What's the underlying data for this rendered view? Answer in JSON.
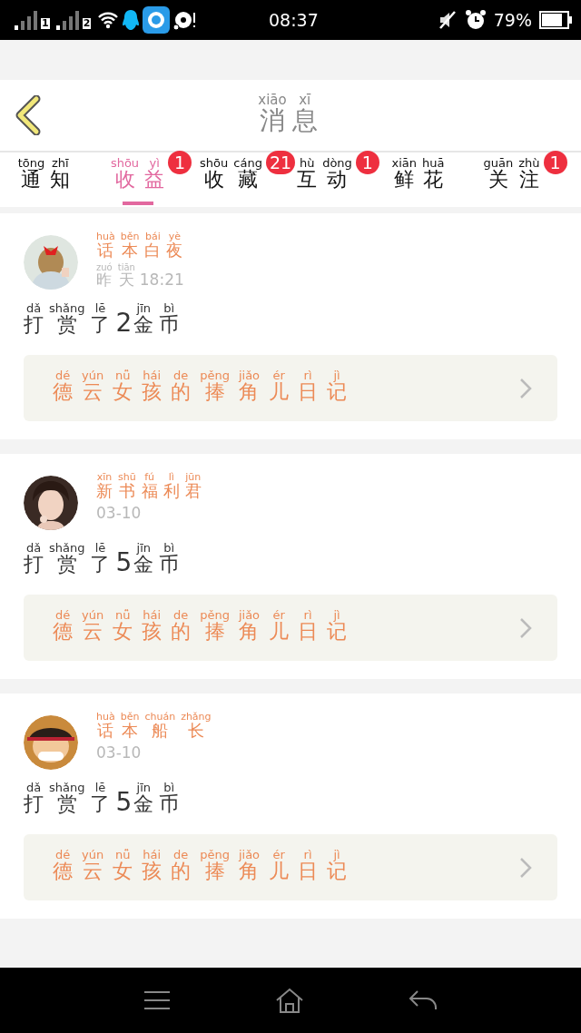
{
  "status_bar": {
    "sim_slots": [
      "1",
      "2"
    ],
    "time": "08:37",
    "battery": "79%"
  },
  "header": {
    "title": [
      {
        "text": "消",
        "pinyin": "xiāo"
      },
      {
        "text": "息",
        "pinyin": "xī"
      }
    ]
  },
  "tabs": [
    {
      "label": [
        {
          "text": "通",
          "pinyin": "tōng"
        },
        {
          "text": "知",
          "pinyin": "zhī"
        }
      ],
      "selected": false
    },
    {
      "label": [
        {
          "text": "收",
          "pinyin": "shōu"
        },
        {
          "text": "益",
          "pinyin": "yì"
        }
      ],
      "selected": true,
      "badge": "1"
    },
    {
      "label": [
        {
          "text": "收",
          "pinyin": "shōu"
        },
        {
          "text": "藏",
          "pinyin": "cáng"
        }
      ],
      "selected": false,
      "badge": "21"
    },
    {
      "label": [
        {
          "text": "互",
          "pinyin": "hù"
        },
        {
          "text": "动",
          "pinyin": "dòng"
        }
      ],
      "selected": false,
      "badge": "1"
    },
    {
      "label": [
        {
          "text": "鲜",
          "pinyin": "xiān"
        },
        {
          "text": "花",
          "pinyin": "huā"
        }
      ],
      "selected": false
    },
    {
      "label": [
        {
          "text": "关",
          "pinyin": "guān"
        },
        {
          "text": "注",
          "pinyin": "zhù"
        }
      ],
      "selected": false,
      "badge": "1"
    }
  ],
  "messages": [
    {
      "sender": [
        {
          "text": "话",
          "pinyin": "huà"
        },
        {
          "text": "本",
          "pinyin": "běn"
        },
        {
          "text": "白",
          "pinyin": "bái"
        },
        {
          "text": "夜",
          "pinyin": "yè"
        }
      ],
      "date": [
        {
          "text": "昨",
          "pinyin": "zuó"
        },
        {
          "text": "天",
          "pinyin": "tiān"
        },
        {
          "text": "18:21"
        }
      ],
      "action": [
        {
          "text": "打",
          "pinyin": "dǎ"
        },
        {
          "text": "赏",
          "pinyin": "shǎng"
        },
        {
          "text": "了",
          "pinyin": "lē"
        },
        {
          "text": "2"
        },
        {
          "text": "金",
          "pinyin": "jīn"
        },
        {
          "text": "币",
          "pinyin": "bì"
        }
      ],
      "book": [
        {
          "text": "德",
          "pinyin": "dé"
        },
        {
          "text": "云",
          "pinyin": "yún"
        },
        {
          "text": "女",
          "pinyin": "nǚ"
        },
        {
          "text": "孩",
          "pinyin": "hái"
        },
        {
          "text": "的",
          "pinyin": "de"
        },
        {
          "text": "捧",
          "pinyin": "pěng"
        },
        {
          "text": "角",
          "pinyin": "jiǎo"
        },
        {
          "text": "儿",
          "pinyin": "ér"
        },
        {
          "text": "日",
          "pinyin": "rì"
        },
        {
          "text": "记",
          "pinyin": "jì"
        }
      ]
    },
    {
      "sender": [
        {
          "text": "新",
          "pinyin": "xīn"
        },
        {
          "text": "书",
          "pinyin": "shū"
        },
        {
          "text": "福",
          "pinyin": "fú"
        },
        {
          "text": "利",
          "pinyin": "lì"
        },
        {
          "text": "君",
          "pinyin": "jūn"
        }
      ],
      "date": [
        {
          "text": "03-10"
        }
      ],
      "action": [
        {
          "text": "打",
          "pinyin": "dǎ"
        },
        {
          "text": "赏",
          "pinyin": "shǎng"
        },
        {
          "text": "了",
          "pinyin": "lē"
        },
        {
          "text": "5"
        },
        {
          "text": "金",
          "pinyin": "jīn"
        },
        {
          "text": "币",
          "pinyin": "bì"
        }
      ],
      "book": [
        {
          "text": "德",
          "pinyin": "dé"
        },
        {
          "text": "云",
          "pinyin": "yún"
        },
        {
          "text": "女",
          "pinyin": "nǚ"
        },
        {
          "text": "孩",
          "pinyin": "hái"
        },
        {
          "text": "的",
          "pinyin": "de"
        },
        {
          "text": "捧",
          "pinyin": "pěng"
        },
        {
          "text": "角",
          "pinyin": "jiǎo"
        },
        {
          "text": "儿",
          "pinyin": "ér"
        },
        {
          "text": "日",
          "pinyin": "rì"
        },
        {
          "text": "记",
          "pinyin": "jì"
        }
      ]
    },
    {
      "sender": [
        {
          "text": "话",
          "pinyin": "huà"
        },
        {
          "text": "本",
          "pinyin": "běn"
        },
        {
          "text": "船",
          "pinyin": "chuán"
        },
        {
          "text": "长",
          "pinyin": "zhǎng"
        }
      ],
      "date": [
        {
          "text": "03-10"
        }
      ],
      "action": [
        {
          "text": "打",
          "pinyin": "dǎ"
        },
        {
          "text": "赏",
          "pinyin": "shǎng"
        },
        {
          "text": "了",
          "pinyin": "lē"
        },
        {
          "text": "5"
        },
        {
          "text": "金",
          "pinyin": "jīn"
        },
        {
          "text": "币",
          "pinyin": "bì"
        }
      ],
      "book": [
        {
          "text": "德",
          "pinyin": "dé"
        },
        {
          "text": "云",
          "pinyin": "yún"
        },
        {
          "text": "女",
          "pinyin": "nǚ"
        },
        {
          "text": "孩",
          "pinyin": "hái"
        },
        {
          "text": "的",
          "pinyin": "de"
        },
        {
          "text": "捧",
          "pinyin": "pěng"
        },
        {
          "text": "角",
          "pinyin": "jiǎo"
        },
        {
          "text": "儿",
          "pinyin": "ér"
        },
        {
          "text": "日",
          "pinyin": "rì"
        },
        {
          "text": "记",
          "pinyin": "jì"
        }
      ]
    }
  ]
}
